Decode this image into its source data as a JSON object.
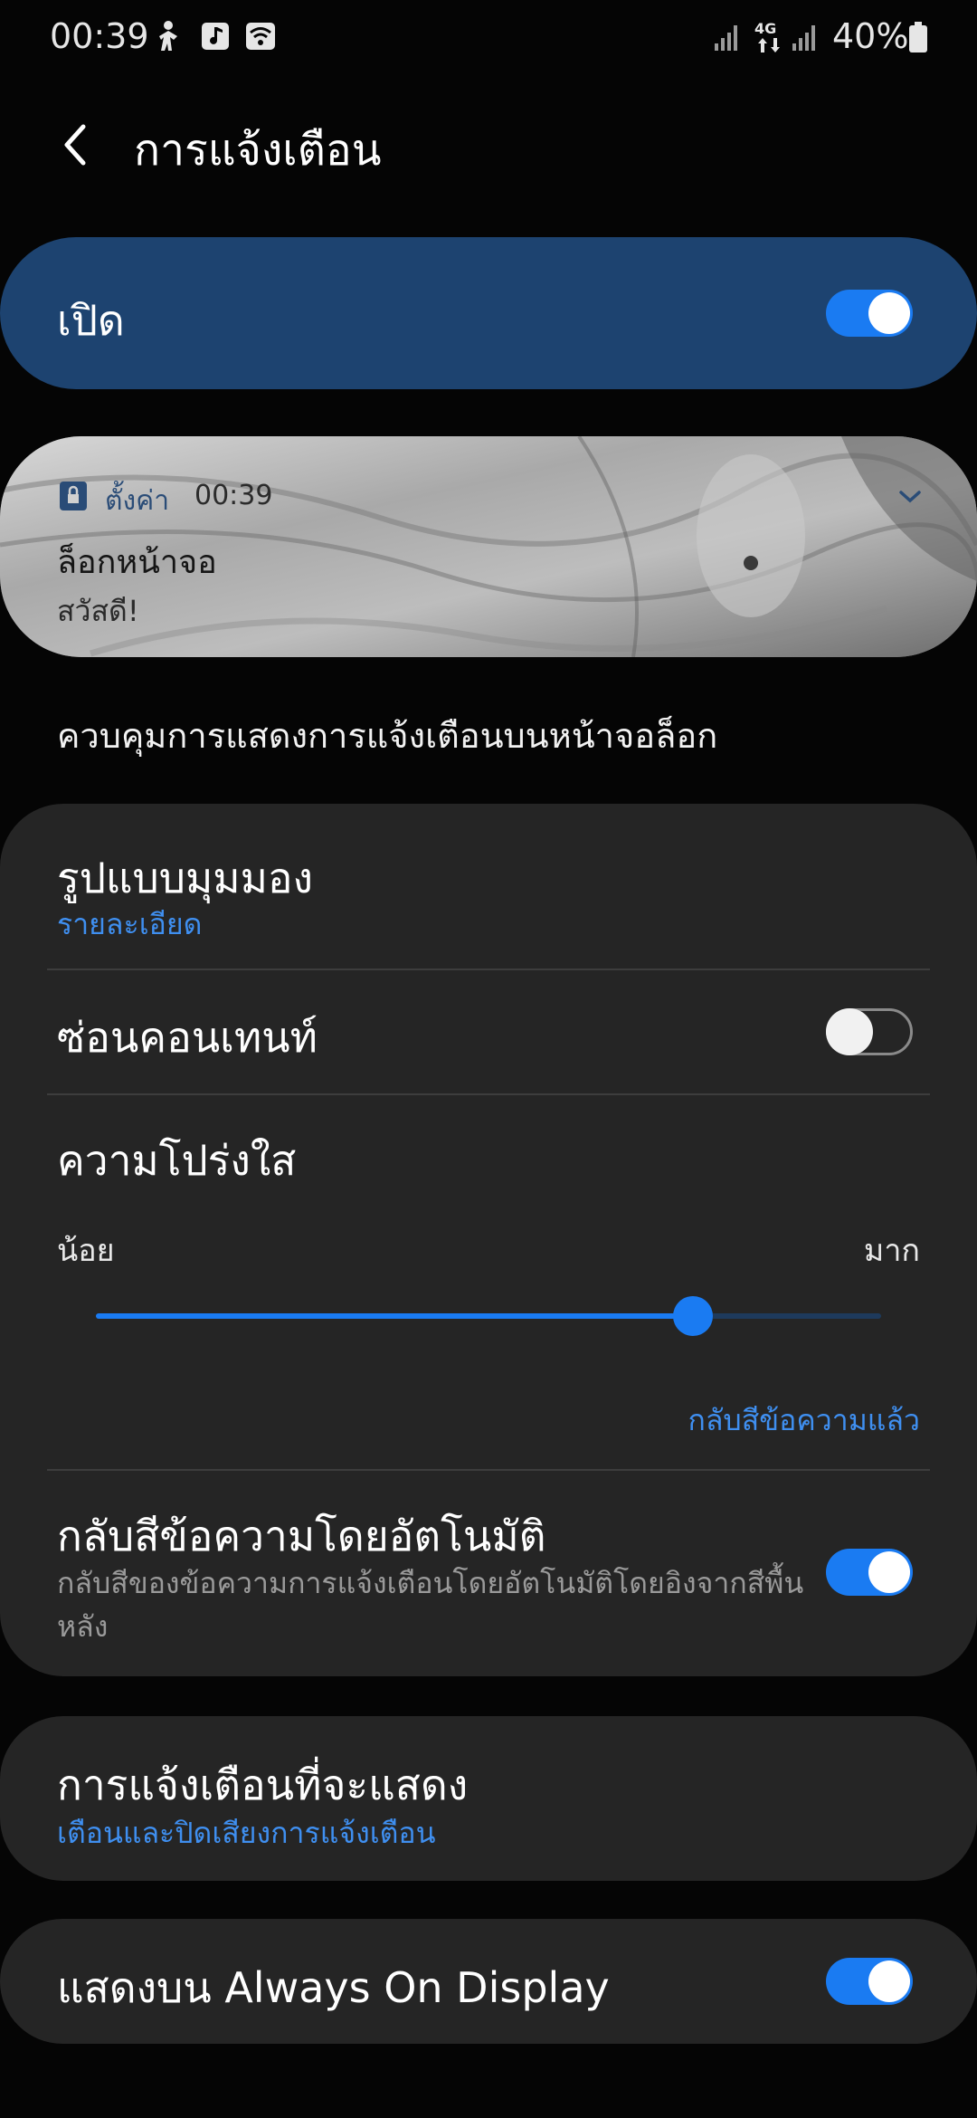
{
  "status_bar": {
    "time": "00:39",
    "battery_percent": "40%",
    "network_label": "4G",
    "icons": [
      "accessibility-icon",
      "music-icon",
      "wifi-icon",
      "signal-icon",
      "data-arrows-icon",
      "battery-icon"
    ]
  },
  "header": {
    "title": "การแจ้งเตือน",
    "back_icon": "back-arrow-icon"
  },
  "master_switch": {
    "label": "เปิด",
    "on": true
  },
  "preview": {
    "app_name": "ตั้งค่า",
    "time": "00:39",
    "title": "ล็อกหน้าจอ",
    "body": "สวัสดี!",
    "icons": [
      "lock-icon",
      "chevron-down-icon"
    ]
  },
  "section_caption": "ควบคุมการแสดงการแจ้งเตือนบนหน้าจอล็อก",
  "settings": {
    "view_style": {
      "title": "รูปแบบมุมมอง",
      "value": "รายละเอียด"
    },
    "hide_content": {
      "title": "ซ่อนคอนเทนท์",
      "on": false
    },
    "transparency": {
      "title": "ความโปร่งใส",
      "min_label": "น้อย",
      "max_label": "มาก",
      "level": 0.76,
      "link": "กลับสีข้อความแล้ว"
    },
    "auto_invert": {
      "title": "กลับสีข้อความโดยอัตโนมัติ",
      "description": "กลับสีของข้อความการแจ้งเตือนโดยอัตโนมัติโดยอิงจากสีพื้นหลัง",
      "on": true
    }
  },
  "notifications_to_show": {
    "title": "การแจ้งเตือนที่จะแสดง",
    "value": "เตือนและปิดเสียงการแจ้งเตือน"
  },
  "always_on_display": {
    "title": "แสดงบน Always On Display",
    "on": true
  },
  "colors": {
    "accent": "#1a7bf2",
    "link": "#3f8ff0",
    "master_card": "#1d4370",
    "card": "#252525",
    "background": "#050505"
  }
}
